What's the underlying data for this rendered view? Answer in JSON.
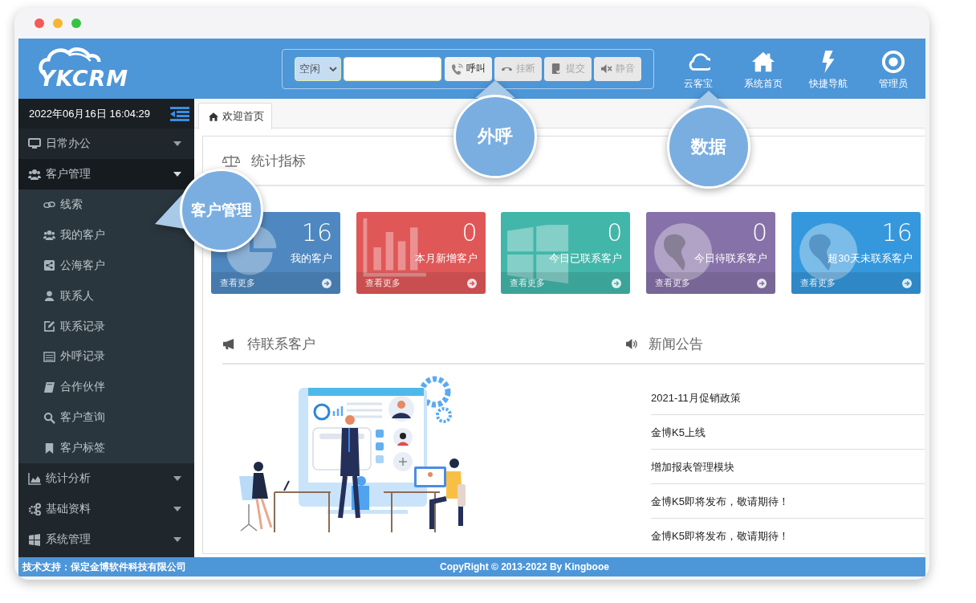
{
  "header": {
    "logo": "YKCRM",
    "phone_bar": {
      "status": "空闲",
      "buttons": [
        {
          "label": "呼叫",
          "disabled": false
        },
        {
          "label": "挂断",
          "disabled": true
        },
        {
          "label": "提交",
          "disabled": true
        },
        {
          "label": "静音",
          "disabled": true
        }
      ]
    },
    "nav": [
      {
        "label": "云客宝"
      },
      {
        "label": "系统首页"
      },
      {
        "label": "快捷导航"
      },
      {
        "label": "管理员"
      }
    ]
  },
  "sidebar": {
    "datetime": "2022年06月16日 16:04:29",
    "menu": [
      {
        "label": "日常办公",
        "expanded": false
      },
      {
        "label": "客户管理",
        "expanded": true,
        "children": [
          {
            "label": "线索"
          },
          {
            "label": "我的客户"
          },
          {
            "label": "公海客户"
          },
          {
            "label": "联系人"
          },
          {
            "label": "联系记录"
          },
          {
            "label": "外呼记录"
          },
          {
            "label": "合作伙伴"
          },
          {
            "label": "客户查询"
          },
          {
            "label": "客户标签"
          }
        ]
      },
      {
        "label": "统计分析",
        "expanded": false
      },
      {
        "label": "基础资料",
        "expanded": false
      },
      {
        "label": "系统管理",
        "expanded": false
      }
    ]
  },
  "tabs": [
    {
      "label": "欢迎首页",
      "selected": true
    }
  ],
  "stats": {
    "title": "统计指标",
    "cards": [
      {
        "value": "16",
        "label": "我的客户",
        "link": "查看更多",
        "color": "#4f88c0"
      },
      {
        "value": "0",
        "label": "本月新增客户",
        "link": "查看更多",
        "color": "#e05758"
      },
      {
        "value": "0",
        "label": "今日已联系客户",
        "link": "查看更多",
        "color": "#43b6aa"
      },
      {
        "value": "0",
        "label": "今日待联系客户",
        "link": "查看更多",
        "color": "#8672a8"
      },
      {
        "value": "16",
        "label": "超30天未联系客户",
        "link": "查看更多",
        "color": "#3598dc"
      }
    ]
  },
  "pending": {
    "title": "待联系客户"
  },
  "news": {
    "title": "新闻公告",
    "items": [
      {
        "title": "2021-11月促销政策"
      },
      {
        "title": "金博K5上线"
      },
      {
        "title": "增加报表管理模块"
      },
      {
        "title": "金博K5即将发布，敬请期待！"
      },
      {
        "title": "金博K5即将发布，敬请期待！"
      }
    ]
  },
  "footer": {
    "support": "技术支持：保定金博软件科技有限公司",
    "copyright": "CopyRight © 2013-2022 By Kingbooe"
  },
  "callouts": [
    {
      "text": "外呼"
    },
    {
      "text": "数据"
    },
    {
      "text": "客户管理"
    }
  ]
}
